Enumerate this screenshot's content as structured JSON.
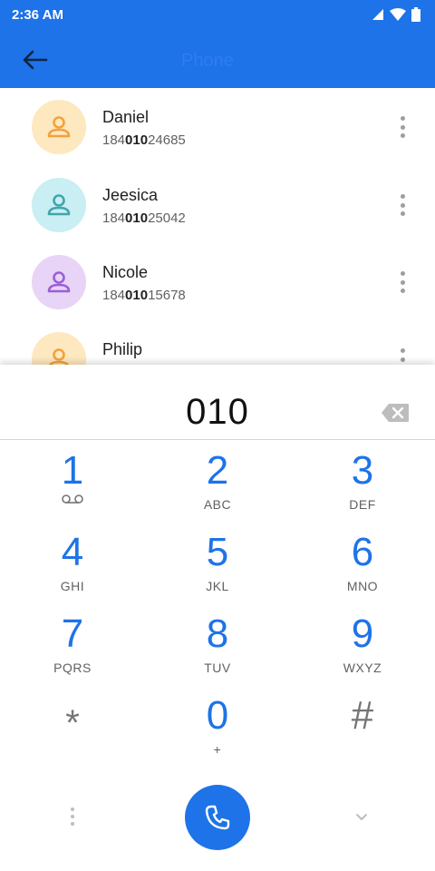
{
  "status_bar": {
    "time": "2:36 AM",
    "icons": [
      "signal-icon",
      "wifi-icon",
      "battery-icon"
    ]
  },
  "app_bar": {
    "title": "Phone",
    "back_icon": "arrow-back-icon"
  },
  "contacts": [
    {
      "name": "Daniel",
      "number_prefix": "184",
      "number_match": "010",
      "number_suffix": "24685",
      "avatar_color": "#fde8bf",
      "icon_color": "#f2a23c"
    },
    {
      "name": "Jeesica",
      "number_prefix": "184",
      "number_match": "010",
      "number_suffix": "25042",
      "avatar_color": "#c9eef3",
      "icon_color": "#3fa6ad"
    },
    {
      "name": "Nicole",
      "number_prefix": "184",
      "number_match": "010",
      "number_suffix": "15678",
      "avatar_color": "#e8d4f6",
      "icon_color": "#9b5fd6"
    },
    {
      "name": "Philip",
      "number_prefix": "",
      "number_match": "",
      "number_suffix": "",
      "avatar_color": "#fde8bf",
      "icon_color": "#f2a23c"
    }
  ],
  "dialpad": {
    "entered_digits": "010",
    "keys": [
      {
        "digit": "1",
        "letters": ""
      },
      {
        "digit": "2",
        "letters": "ABC"
      },
      {
        "digit": "3",
        "letters": "DEF"
      },
      {
        "digit": "4",
        "letters": "GHI"
      },
      {
        "digit": "5",
        "letters": "JKL"
      },
      {
        "digit": "6",
        "letters": "MNO"
      },
      {
        "digit": "7",
        "letters": "PQRS"
      },
      {
        "digit": "8",
        "letters": "TUV"
      },
      {
        "digit": "9",
        "letters": "WXYZ"
      },
      {
        "digit": "*",
        "letters": ""
      },
      {
        "digit": "0",
        "letters": "+"
      },
      {
        "digit": "#",
        "letters": ""
      }
    ]
  },
  "colors": {
    "accent": "#1e73e8",
    "secondary_text": "#616161"
  }
}
